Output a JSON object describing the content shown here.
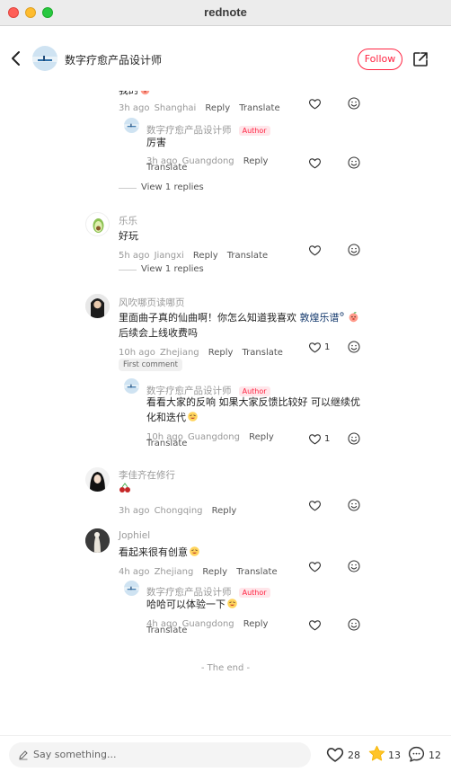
{
  "window": {
    "title": "rednote"
  },
  "header": {
    "author_name": "数字疗愈产品设计师",
    "follow_label": "Follow"
  },
  "comments": [
    {
      "text": "我的",
      "time": "3h ago",
      "location": "Shanghai",
      "reply_label": "Reply",
      "translate_label": "Translate",
      "replies": [
        {
          "name": "数字疗愈产品设计师",
          "badge": "Author",
          "text": "厉害",
          "time": "3h ago",
          "location": "Guangdong",
          "reply_label": "Reply",
          "translate_label": "Translate"
        }
      ],
      "view_replies": "View 1 replies"
    },
    {
      "name": "乐乐",
      "text": "好玩",
      "time": "5h ago",
      "location": "Jiangxi",
      "reply_label": "Reply",
      "translate_label": "Translate",
      "view_replies": "View 1 replies"
    },
    {
      "name": "风吹哪页读哪页",
      "text_before": "里面曲子真的仙曲啊！你怎么知道我喜欢",
      "link": "敦煌乐谱",
      "text_line2": "后续会上线收费吗",
      "time": "10h ago",
      "location": "Zhejiang",
      "reply_label": "Reply",
      "translate_label": "Translate",
      "likes": "1",
      "badge": "First comment",
      "replies": [
        {
          "name": "数字疗愈产品设计师",
          "badge": "Author",
          "text_line1": "看看大家的反响 如果大家反馈比较好 可以继续优",
          "text_line2": "化和迭代",
          "time": "10h ago",
          "location": "Guangdong",
          "reply_label": "Reply",
          "translate_label": "Translate",
          "likes": "1"
        }
      ]
    },
    {
      "name": "李佳齐在修行",
      "time": "3h ago",
      "location": "Chongqing",
      "reply_label": "Reply"
    },
    {
      "name": "Jophiel",
      "text": "看起来很有创意",
      "time": "4h ago",
      "location": "Zhejiang",
      "reply_label": "Reply",
      "translate_label": "Translate",
      "replies": [
        {
          "name": "数字疗愈产品设计师",
          "badge": "Author",
          "text": "哈哈可以体验一下",
          "time": "4h ago",
          "location": "Guangdong",
          "reply_label": "Reply",
          "translate_label": "Translate"
        }
      ]
    }
  ],
  "end_text": "- The end -",
  "bottom": {
    "placeholder": "Say something...",
    "likes": "28",
    "stars": "13",
    "comments": "12"
  },
  "colors": {
    "accent": "#ff2442",
    "star": "#ffc428",
    "link": "#13386c"
  }
}
